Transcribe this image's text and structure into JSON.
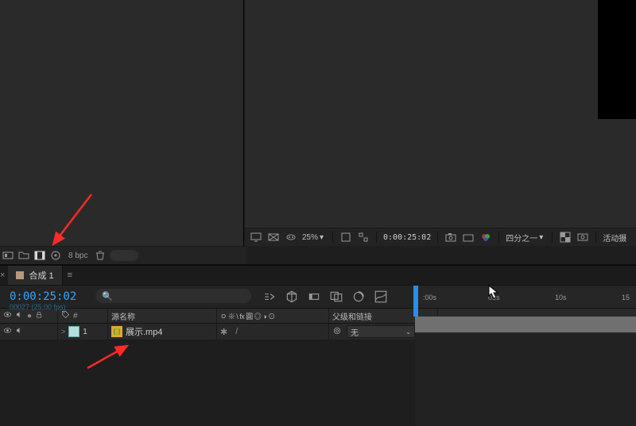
{
  "projectToolbar": {
    "bpc": "8 bpc"
  },
  "compToolbar": {
    "zoom": "25%",
    "timecode": "0:00:25:02",
    "resolution": "四分之一",
    "camera": "活动摄"
  },
  "timeline": {
    "tab": {
      "close": "×",
      "name": "合成 1",
      "menu": "≡"
    },
    "timecode": "0:00:25:02",
    "frameinfo": "00027 (25.00 fps)",
    "ruler": [
      ":00s",
      "05s",
      "10s",
      "15"
    ],
    "columns": {
      "source": "源名称",
      "switches": "ㅇ ※ \\ fx 圓 ◎ ◑ ⊙",
      "parent": "父级和链接"
    },
    "layer1": {
      "index": "1",
      "name": "展示.mp4",
      "parent": "无"
    },
    "icons": {
      "tag": "▸",
      "hash": "#",
      "eye": "●",
      "spk": "🔊",
      "lock": "🔒",
      "chev": ">"
    }
  }
}
